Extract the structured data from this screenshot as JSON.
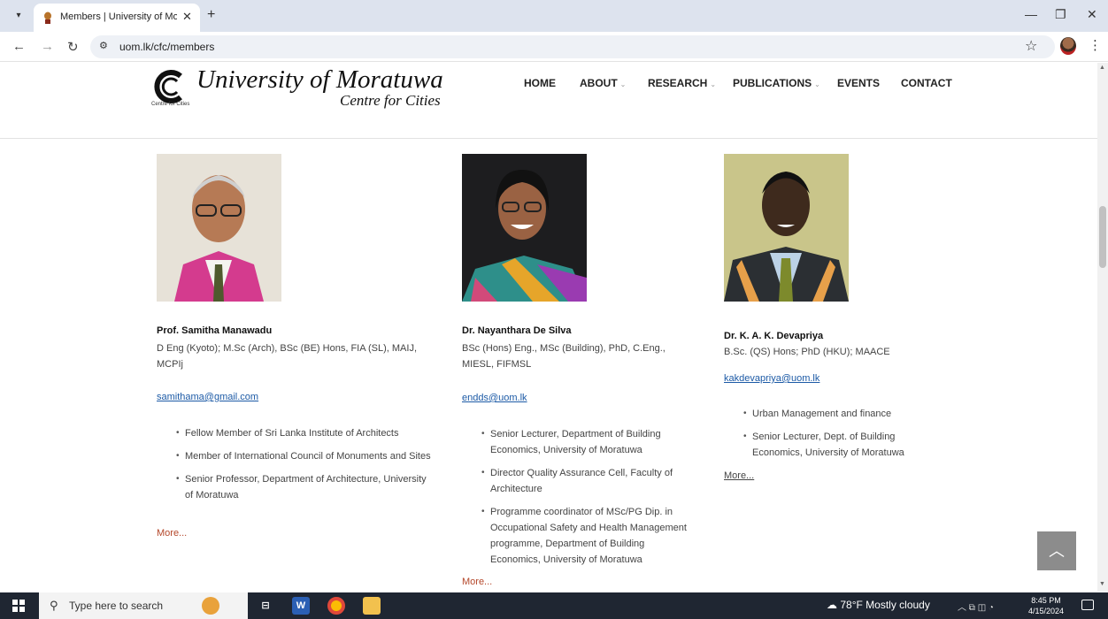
{
  "browser": {
    "tab_title": "Members | University of Moratu",
    "url": "uom.lk/cfc/members"
  },
  "site": {
    "logo_title": "University of Moratuwa",
    "logo_subtitle": "Centre for Cities",
    "logo_small": "Centre for Cities",
    "nav": [
      {
        "label": "HOME"
      },
      {
        "label": "ABOUT",
        "chevron": "⌄"
      },
      {
        "label": "RESEARCH",
        "chevron": "⌄"
      },
      {
        "label": "PUBLICATIONS",
        "chevron": "⌄"
      },
      {
        "label": "EVENTS"
      },
      {
        "label": "CONTACT"
      }
    ]
  },
  "members": [
    {
      "name": "Prof. Samitha Manawadu",
      "qualifications": "D Eng (Kyoto); M.Sc (Arch), BSc (BE) Hons, FIA (SL), MAIJ, MCPIj",
      "email": "samithama@gmail.com",
      "roles": [
        "Fellow Member of Sri Lanka Institute of Architects",
        "Member of International Council of Monuments and Sites",
        "Senior Professor, Department of Architecture, University of Moratuwa"
      ],
      "more": "More..."
    },
    {
      "name": "Dr. Nayanthara  De Silva",
      "qualifications": "BSc (Hons) Eng., MSc (Building), PhD, C.Eng., MIESL, FIFMSL",
      "email": "endds@uom.lk",
      "roles": [
        "Senior Lecturer, Department of Building Economics, University of Moratuwa",
        "Director Quality Assurance Cell, Faculty of Architecture",
        "Programme coordinator of MSc/PG Dip. in Occupational Safety and Health Management programme, Department of Building Economics, University of Moratuwa"
      ],
      "more": "More..."
    },
    {
      "name": "Dr.  K. A. K. Devapriya",
      "qualifications": "B.Sc. (QS) Hons; PhD (HKU); MAACE",
      "email": "kakdevapriya@uom.lk",
      "roles": [
        "Urban Management and finance",
        "Senior Lecturer, Dept. of Building Economics, University of Moratuwa"
      ],
      "more": "More..."
    }
  ],
  "taskbar": {
    "search_placeholder": "Type here to search",
    "weather": "78°F  Mostly cloudy",
    "time": "8:45 PM",
    "date": "4/15/2024"
  }
}
